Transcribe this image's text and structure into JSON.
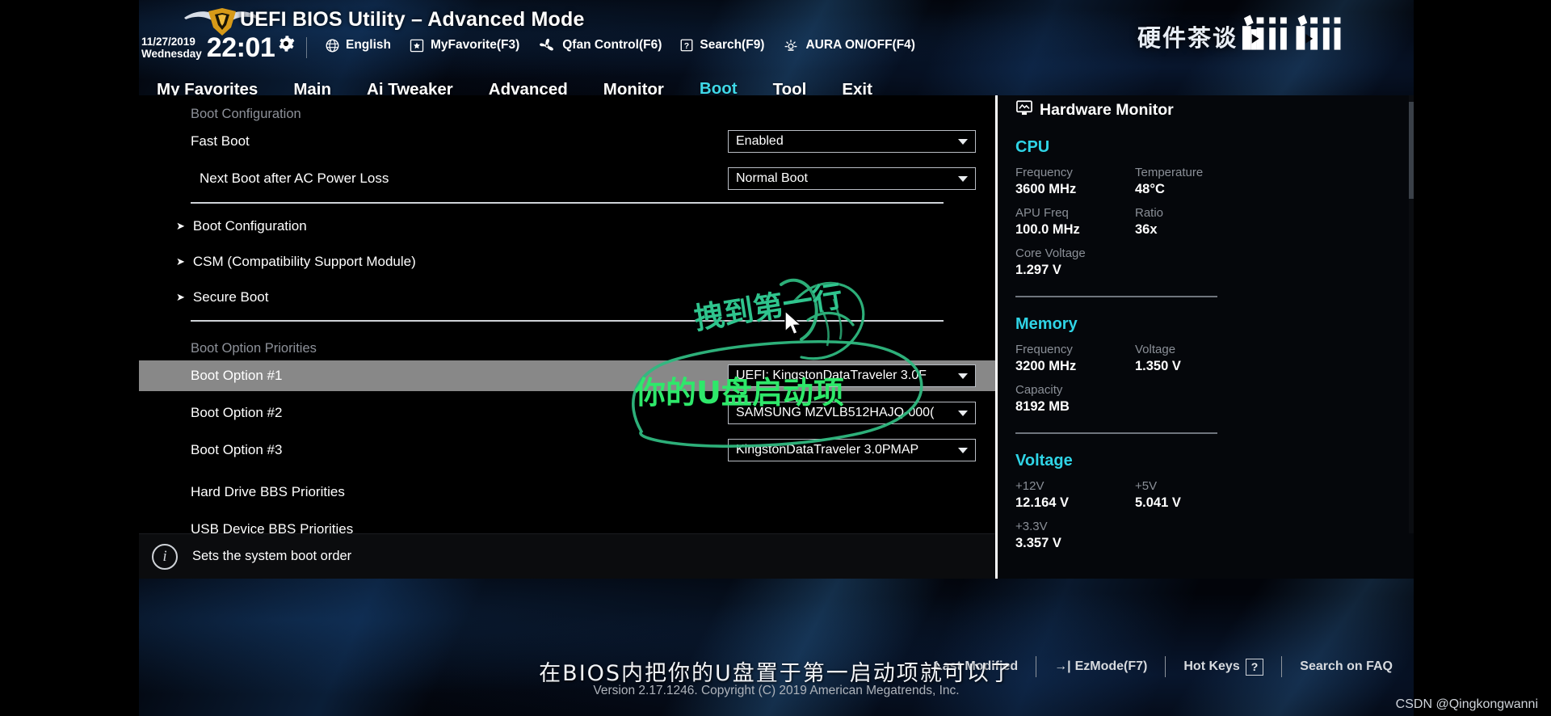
{
  "header": {
    "title": "UEFI BIOS Utility – Advanced Mode",
    "date": "11/27/2019",
    "weekday": "Wednesday",
    "time": "22:01",
    "gear_icon": "gear-icon",
    "items": [
      {
        "label": "English",
        "icon": "globe-icon"
      },
      {
        "label": "MyFavorite(F3)",
        "icon": "star-list-icon"
      },
      {
        "label": "Qfan Control(F6)",
        "icon": "fan-icon"
      },
      {
        "label": "Search(F9)",
        "icon": "question-box-icon"
      },
      {
        "label": "AURA ON/OFF(F4)",
        "icon": "aura-light-icon"
      }
    ],
    "brand_cn": "硬件茶谈",
    "bili_logo": "bilibili-logo"
  },
  "menu": {
    "items": [
      {
        "label": "My Favorites",
        "active": false
      },
      {
        "label": "Main",
        "active": false
      },
      {
        "label": "Ai Tweaker",
        "active": false
      },
      {
        "label": "Advanced",
        "active": false
      },
      {
        "label": "Monitor",
        "active": false
      },
      {
        "label": "Boot",
        "active": true
      },
      {
        "label": "Tool",
        "active": false
      },
      {
        "label": "Exit",
        "active": false
      }
    ]
  },
  "content": {
    "section_boot_config": "Boot Configuration",
    "fast_boot": {
      "label": "Fast Boot",
      "value": "Enabled"
    },
    "next_boot": {
      "label": "Next Boot after AC Power Loss",
      "value": "Normal Boot"
    },
    "submenus": [
      {
        "label": "Boot Configuration"
      },
      {
        "label": "CSM (Compatibility Support Module)"
      },
      {
        "label": "Secure Boot"
      }
    ],
    "section_priorities": "Boot Option Priorities",
    "boot_options": [
      {
        "label": "Boot Option #1",
        "value": "UEFI: KingstonDataTraveler 3.0F",
        "highlight": true
      },
      {
        "label": "Boot Option #2",
        "value": "SAMSUNG MZVLB512HAJQ-000(",
        "highlight": false
      },
      {
        "label": "Boot Option #3",
        "value": "KingstonDataTraveler 3.0PMAP",
        "highlight": false
      }
    ],
    "bbs": [
      {
        "label": "Hard Drive BBS Priorities"
      },
      {
        "label": "USB Device BBS Priorities"
      }
    ]
  },
  "info_bar": {
    "icon": "info-icon",
    "text": "Sets the system boot order"
  },
  "hardware_monitor": {
    "title": "Hardware Monitor",
    "title_icon": "monitor-icon",
    "groups": [
      {
        "name": "CPU",
        "metrics": [
          {
            "key": "Frequency",
            "value": "3600 MHz"
          },
          {
            "key": "Temperature",
            "value": "48°C"
          },
          {
            "key": "APU Freq",
            "value": "100.0 MHz"
          },
          {
            "key": "Ratio",
            "value": "36x"
          },
          {
            "key": "Core Voltage",
            "value": "1.297 V"
          }
        ]
      },
      {
        "name": "Memory",
        "metrics": [
          {
            "key": "Frequency",
            "value": "3200 MHz"
          },
          {
            "key": "Voltage",
            "value": "1.350 V"
          },
          {
            "key": "Capacity",
            "value": "8192 MB"
          }
        ]
      },
      {
        "name": "Voltage",
        "metrics": [
          {
            "key": "+12V",
            "value": "12.164 V"
          },
          {
            "key": "+5V",
            "value": "5.041 V"
          },
          {
            "key": "+3.3V",
            "value": "3.357 V"
          }
        ]
      }
    ]
  },
  "footer": {
    "last_modified": "Last Modified",
    "ez_mode": "EzMode(F7)",
    "ez_mode_arrow": "→|",
    "hot_keys": "Hot Keys",
    "hot_keys_badge": "?",
    "search_faq": "Search on FAQ",
    "version": "Version 2.17.1246. Copyright (C) 2019 American Megatrends, Inc."
  },
  "annotations": {
    "drag_note": "拽到第一行",
    "usb_note": "你的U盘启动项",
    "subtitle": "在BIOS内把你的U盘置于第一启动项就可以了",
    "watermark": "CSDN @Qingkongwanni",
    "cursor": "mouse-cursor",
    "ink_color": "#2fc48d"
  }
}
